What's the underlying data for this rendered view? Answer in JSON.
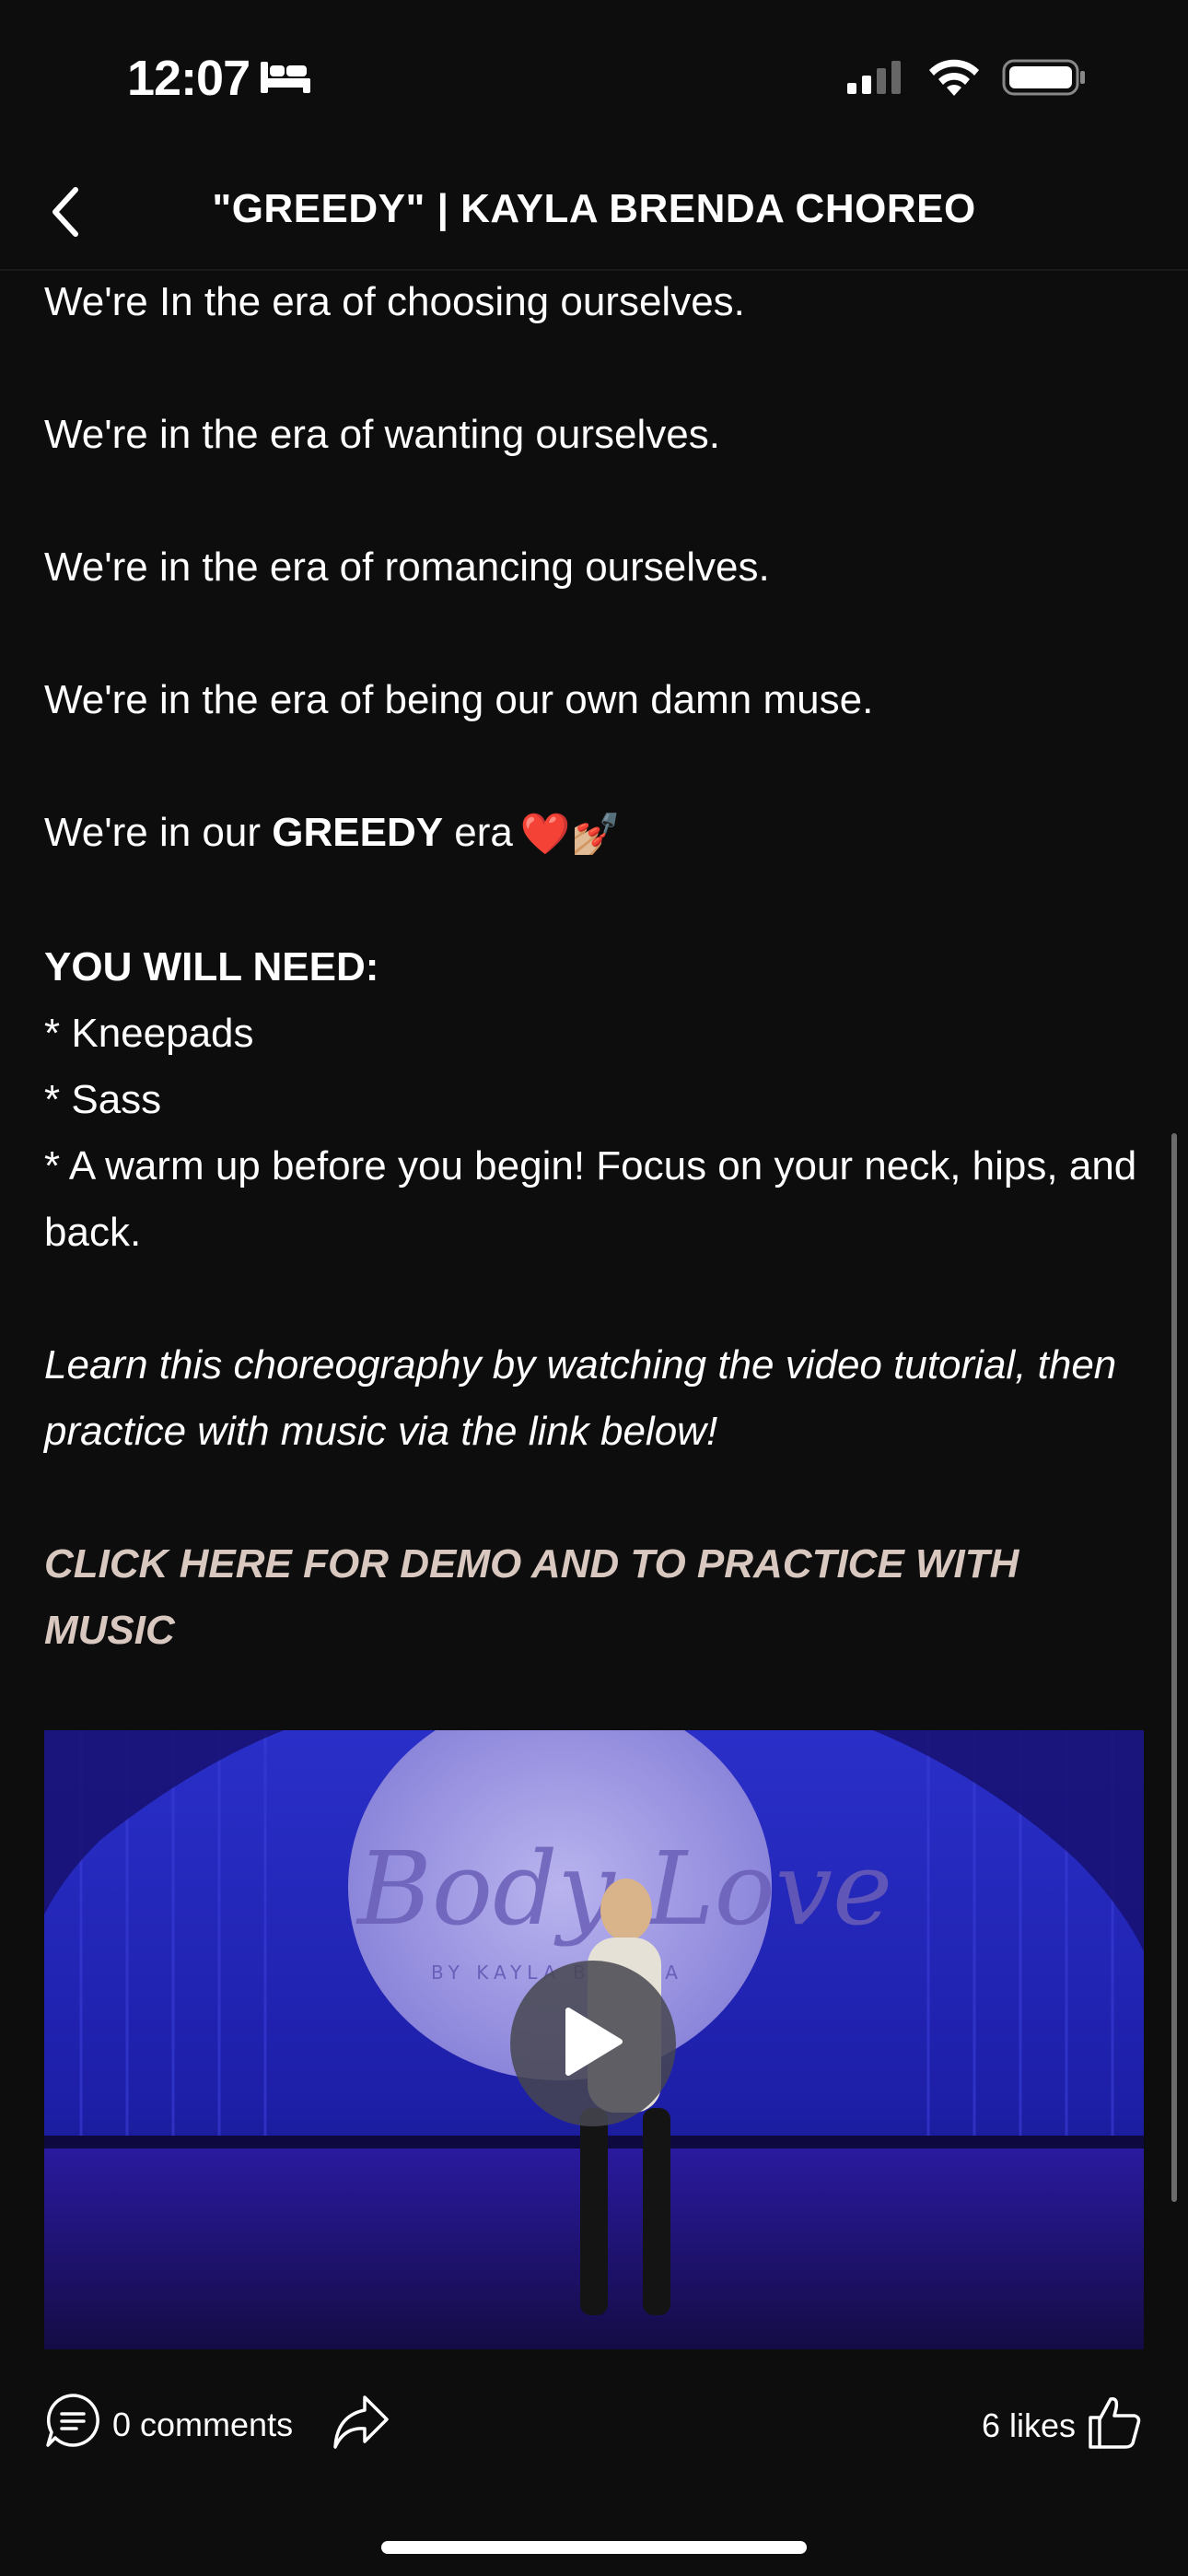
{
  "status_bar": {
    "time": "12:07",
    "sleep_icon": "bed-icon",
    "signal_icon": "cellular-signal-icon",
    "wifi_icon": "wifi-icon",
    "battery_icon": "battery-icon"
  },
  "header": {
    "title": "\"GREEDY\" | KAYLA BRENDA CHOREO",
    "back_icon": "chevron-left-icon"
  },
  "body": {
    "line1": "We're In the era of choosing ourselves.",
    "line2": "We're in the era of wanting ourselves.",
    "line3": "We're in the era of romancing ourselves.",
    "line4": "We're in the era of being our own damn muse.",
    "line5_prefix": "We're in our ",
    "line5_bold": "GREEDY",
    "line5_suffix": " era",
    "line5_emoji": "❤️💅🏼",
    "need_heading": "YOU WILL NEED:",
    "need_items": [
      "* Kneepads",
      "* Sass",
      "* A warm up before you begin! Focus on your neck, hips, and back."
    ],
    "instructions": "Learn this choreography by watching the video tutorial, then practice with music via the link below!",
    "cta_link": "CLICK HERE FOR DEMO AND TO PRACTICE WITH MUSIC"
  },
  "video": {
    "play_icon": "play-icon",
    "logo_text": "Body Love",
    "logo_subtext": "BY KAYLA BRENDA"
  },
  "actions": {
    "comments_label": "0 comments",
    "comments_icon": "comment-bubble-icon",
    "share_icon": "share-arrow-icon",
    "likes_label": "6 likes",
    "like_icon": "thumbs-up-icon"
  },
  "colors": {
    "background": "#0d0d0d",
    "text": "#ffffff",
    "cta": "#d9c8c0",
    "video_blue": "#1a1680"
  }
}
